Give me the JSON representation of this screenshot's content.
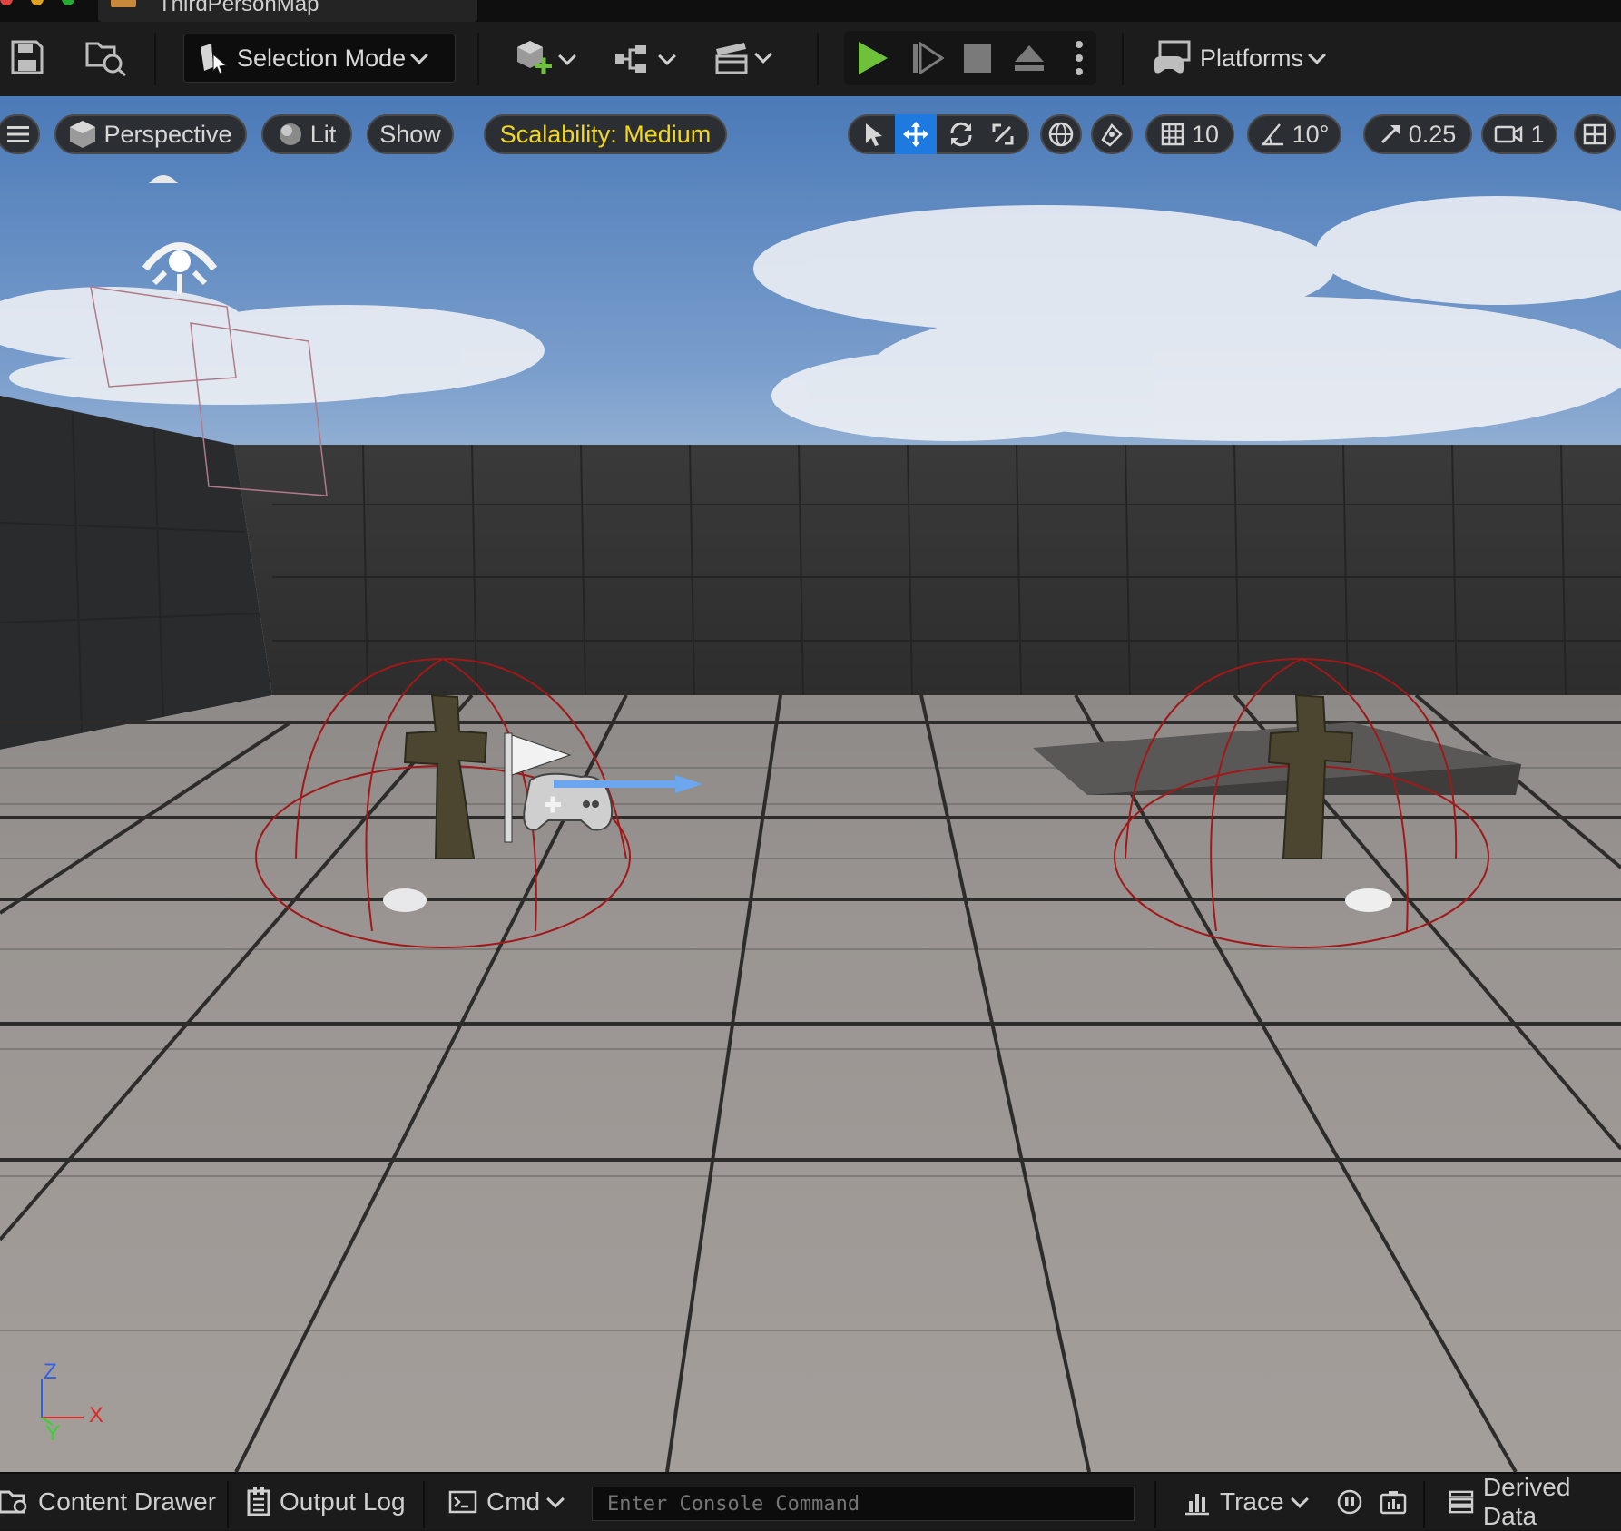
{
  "window": {
    "level_tab": "ThirdPersonMap"
  },
  "toolbar": {
    "selection_mode": "Selection Mode",
    "platforms": "Platforms"
  },
  "viewport": {
    "perspective": "Perspective",
    "lit": "Lit",
    "show": "Show",
    "scalability": "Scalability: Medium",
    "grid_snap": "10",
    "rotation_snap": "10°",
    "scale_snap": "0.25",
    "camera_speed": "1",
    "axis": {
      "z": "Z",
      "x": "X",
      "y": "Y"
    }
  },
  "statusbar": {
    "content_drawer": "Content Drawer",
    "output_log": "Output Log",
    "cmd": "Cmd",
    "console_placeholder": "Enter Console Command",
    "trace": "Trace",
    "derived_data": "Derived Data"
  },
  "colors": {
    "play_green": "#6fc13b",
    "select_blue": "#1f7ae0",
    "scalability_yellow": "#f2d71a",
    "axis_x": "#e02525",
    "axis_y": "#2fd62f",
    "axis_z": "#2f5fe6"
  }
}
